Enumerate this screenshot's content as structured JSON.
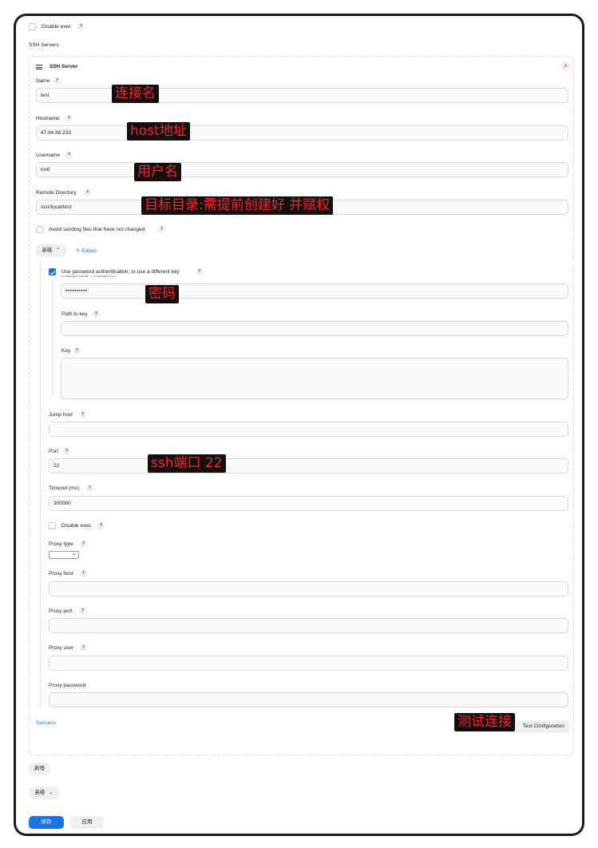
{
  "top": {
    "disable_exec_label": "Disable exec",
    "help": "?"
  },
  "section_title": "SSH Servers",
  "server": {
    "title": "SSH Server",
    "close": "×",
    "name_label": "Name",
    "name_value": "test",
    "hostname_label": "Hostname",
    "hostname_value": "47.94.88.233",
    "username_label": "Username",
    "username_value": "root",
    "remote_dir_label": "Remote Directory",
    "remote_dir_value": "/usr/local/test",
    "avoid_label": "Avoid sending files that have not changed",
    "advanced_label": "高级",
    "edited_label": "Edited",
    "use_password_label": "Use password authentication, or use a different key",
    "passphrase_label": "Passphrase / Password",
    "passphrase_value": "••••••••••",
    "path_to_key_label": "Path to key",
    "key_label": "Key",
    "jump_host_label": "Jump host",
    "port_label": "Port",
    "port_value": "22",
    "timeout_label": "Timeout (ms)",
    "timeout_value": "300000",
    "disable_exec_label": "Disable exec",
    "proxy_type_label": "Proxy type",
    "proxy_host_label": "Proxy host",
    "proxy_port_label": "Proxy port",
    "proxy_user_label": "Proxy user",
    "proxy_password_label": "Proxy password",
    "success_text": "Success",
    "test_config_label": "Test Configuration"
  },
  "annotations": {
    "name": "连接名",
    "hostname": "host地址",
    "username": "用户名",
    "remote_dir": "目标目录:需提前创建好 并赋权",
    "password": "密码",
    "port": "ssh端口 22",
    "test": "测试连接"
  },
  "footer": {
    "add_label": "新增",
    "advanced_label": "高级",
    "save_label": "保存",
    "apply_label": "应用"
  },
  "colors": {
    "primary": "#1a73e8",
    "annotation_text": "#ff2020",
    "annotation_bg": "#111111",
    "link": "#1a73e8"
  }
}
